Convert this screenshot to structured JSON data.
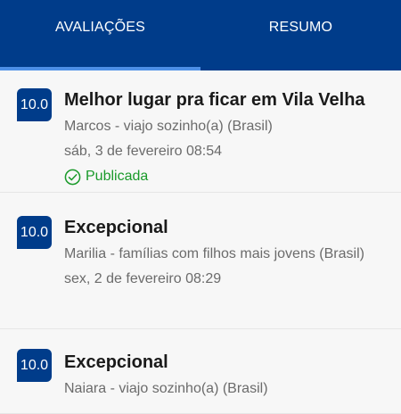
{
  "tabs": [
    {
      "label": "AVALIAÇÕES",
      "active": true
    },
    {
      "label": "RESUMO",
      "active": false
    }
  ],
  "colors": {
    "primary": "#003c8a",
    "indicator": "#4d8fe6",
    "published": "#1a9a2a"
  },
  "reviews": [
    {
      "score": "10.0",
      "title": "Melhor lugar pra ficar em Vila Velha",
      "author": "Marcos - viajo sozinho(a) (Brasil)",
      "date": "sáb, 3 de fevereiro 08:54",
      "status": "Publicada",
      "status_icon": "check-circle-icon"
    },
    {
      "score": "10.0",
      "title": "Excepcional",
      "author": "Marilia - famílias com filhos mais jovens (Brasil)",
      "date": "sex, 2 de fevereiro 08:29"
    },
    {
      "score": "10.0",
      "title": "Excepcional",
      "author": "Naiara - viajo sozinho(a) (Brasil)"
    }
  ]
}
